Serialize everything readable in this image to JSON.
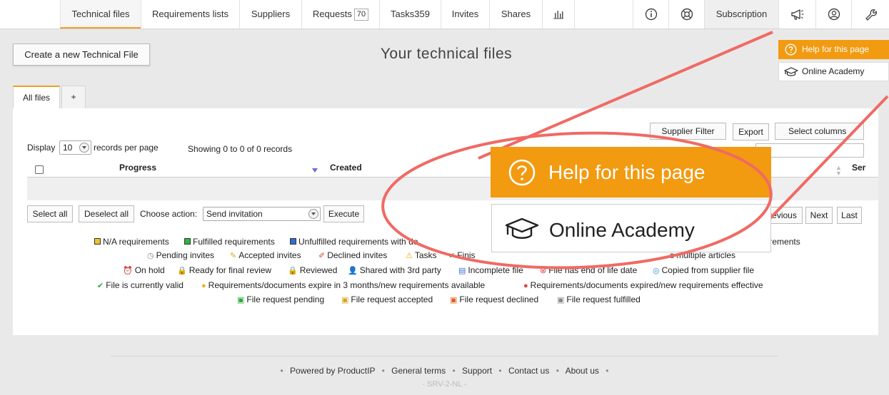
{
  "nav": {
    "technical_files": "Technical files",
    "requirements_lists": "Requirements lists",
    "suppliers": "Suppliers",
    "requests": "Requests",
    "requests_count": "70",
    "tasks": "Tasks359",
    "invites": "Invites",
    "shares": "Shares",
    "subscription": "Subscription"
  },
  "header": {
    "create_button": "Create a new Technical File",
    "title": "Your technical files",
    "help_label": "Help for this page",
    "academy_label": "Online Academy"
  },
  "tabs": {
    "all_files": "All files",
    "add": "+"
  },
  "table": {
    "display_label": "Display",
    "display_value": "10",
    "per_page_label": "records per page",
    "showing": "Showing 0 to 0 of 0 records",
    "supplier_filter": "Supplier Filter",
    "export": "Export",
    "select_columns": "Select columns",
    "col_progress": "Progress",
    "col_created": "Created",
    "col_ser": "Ser",
    "select_all": "Select all",
    "deselect_all": "Deselect all",
    "choose_action": "Choose action:",
    "action_value": "Send invitation",
    "execute": "Execute",
    "previous": "revious",
    "next": "Next",
    "last": "Last"
  },
  "legend": {
    "row1": [
      {
        "label": "N/A requirements",
        "color": "#e8c52a"
      },
      {
        "label": "Fulfilled requirements",
        "color": "#2fb63b"
      },
      {
        "label": "Unfulfilled requirements with do",
        "color": "#2f6fd6"
      },
      {
        "label": "no requirements",
        "color": "#ffffff"
      }
    ],
    "row2": [
      "Pending invites",
      "Accepted invites",
      "Declined invites",
      "Tasks",
      "Finis",
      "s multiple articles"
    ],
    "row3": [
      "On hold",
      "Ready for final review",
      "Reviewed",
      "Shared with 3rd party",
      "Incomplete file",
      "File has end of life date",
      "Copied from supplier file"
    ],
    "row4": [
      "File is currently valid",
      "Requirements/documents expire in 3 months/new requirements available",
      "Requirements/documents expired/new requirements effective"
    ],
    "row5": [
      "File request pending",
      "File request accepted",
      "File request declined",
      "File request fulfilled"
    ]
  },
  "footer": {
    "powered": "Powered by ProductIP",
    "terms": "General terms",
    "support": "Support",
    "contact": "Contact us",
    "about": "About us",
    "server": "- SRV-2-NL -"
  },
  "colors": {
    "accent": "#f29a10",
    "annotation": "#f06a64"
  }
}
